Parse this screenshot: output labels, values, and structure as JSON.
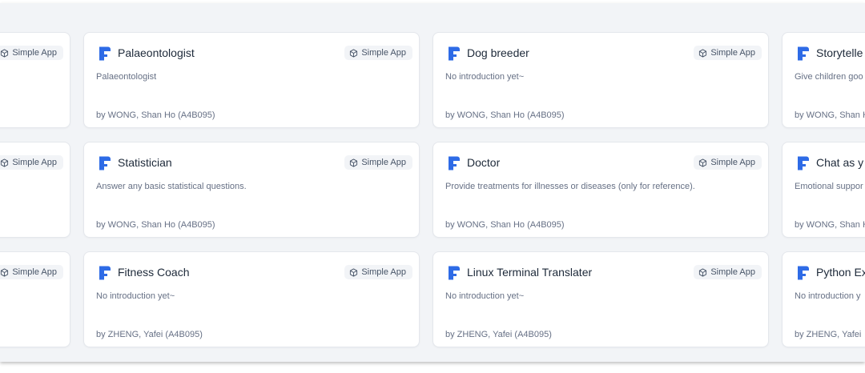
{
  "badge_label": "Simple App",
  "colors": {
    "background": "#f2f4f7",
    "card": "#ffffff",
    "logo": "#2e6be6",
    "title": "#1d2939",
    "muted": "#667085"
  },
  "rows": [
    {
      "cards": [
        {
          "title": "",
          "description": "",
          "author": ""
        },
        {
          "title": "Palaeontologist",
          "description": "Palaeontologist",
          "author": "by WONG, Shan Ho (A4B095)"
        },
        {
          "title": "Dog breeder",
          "description": "No introduction yet~",
          "author": "by WONG, Shan Ho (A4B095)"
        },
        {
          "title": "Storytelle",
          "description": "Give children goo",
          "author": "by WONG, Shan H"
        }
      ]
    },
    {
      "cards": [
        {
          "title": "",
          "description": "",
          "author": ""
        },
        {
          "title": "Statistician",
          "description": "Answer any basic statistical questions.",
          "author": "by WONG, Shan Ho (A4B095)"
        },
        {
          "title": "Doctor",
          "description": "Provide treatments for illnesses or diseases (only for reference).",
          "author": "by WONG, Shan Ho (A4B095)"
        },
        {
          "title": "Chat as y",
          "description": "Emotional suppor",
          "author": "by WONG, Shan H"
        }
      ]
    },
    {
      "cards": [
        {
          "title": "",
          "description": "",
          "author": ""
        },
        {
          "title": "Fitness Coach",
          "description": "No introduction yet~",
          "author": "by ZHENG, Yafei (A4B095)"
        },
        {
          "title": "Linux Terminal Translater",
          "description": "No introduction yet~",
          "author": "by ZHENG, Yafei (A4B095)"
        },
        {
          "title": "Python Ex",
          "description": "No introduction y",
          "author": "by ZHENG, Yafei"
        }
      ]
    }
  ]
}
